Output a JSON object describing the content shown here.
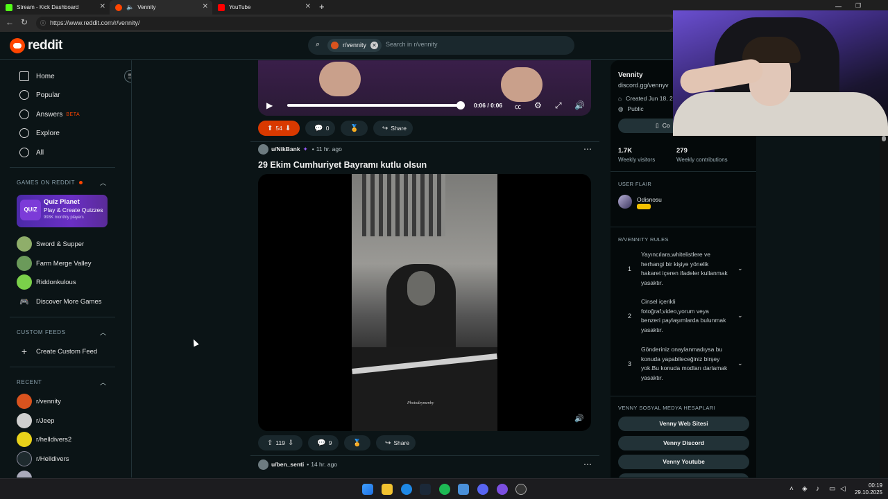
{
  "browser": {
    "tabs": [
      {
        "title": "Stream - Kick Dashboard",
        "favicon_color": "#53fc18"
      },
      {
        "title": "Vennity",
        "favicon_color": "#ff4500"
      },
      {
        "title": "YouTube",
        "favicon_color": "#ff0000"
      }
    ],
    "url": "https://www.reddit.com/r/vennity/"
  },
  "header": {
    "logo_text": "reddit",
    "search_chip": "r/vennity",
    "search_placeholder": "Search in r/vennity"
  },
  "leftnav": {
    "items": [
      {
        "label": "Home"
      },
      {
        "label": "Popular"
      },
      {
        "label": "Answers",
        "badge": "BETA"
      },
      {
        "label": "Explore"
      },
      {
        "label": "All"
      }
    ],
    "games_header": "GAMES ON REDDIT",
    "quiz": {
      "logo": "QUIZ",
      "title": "Quiz Planet",
      "subtitle": "Play & Create Quizzes",
      "players": "993K monthly players"
    },
    "games": [
      {
        "label": "Sword & Supper"
      },
      {
        "label": "Farm Merge Valley"
      },
      {
        "label": "Riddonkulous"
      },
      {
        "label": "Discover More Games"
      }
    ],
    "custom_header": "CUSTOM FEEDS",
    "create_feed": "Create Custom Feed",
    "recent_header": "RECENT",
    "recent": [
      {
        "label": "r/vennity"
      },
      {
        "label": "r/Jeep"
      },
      {
        "label": "r/helldivers2"
      },
      {
        "label": "r/Helldivers"
      }
    ]
  },
  "feed": {
    "post1": {
      "time": "0:06 / 0:06",
      "votes": "54",
      "comments": "0",
      "share": "Share"
    },
    "post2": {
      "user": "u/NikBank",
      "age": "11 hr. ago",
      "title": "29 Ekim Cumhuriyet Bayramı kutlu olsun",
      "watermark": "Photodeymenby",
      "votes": "119",
      "comments": "9",
      "share": "Share"
    },
    "post3": {
      "user": "u/ben_senti",
      "age": "14 hr. ago"
    }
  },
  "sidebar": {
    "name": "Vennity",
    "discord": "discord.gg/vennyv",
    "created": "Created Jun 18, 2",
    "visibility": "Public",
    "button_fragment": "Co",
    "visitors": "1.7K",
    "visitors_label": "Weekly visitors",
    "contributions": "279",
    "contributions_label": "Weekly contributions",
    "flair_header": "USER FLAIR",
    "flair_user": "Odisnosu",
    "rules_header": "R/VENNITY RULES",
    "rules": [
      {
        "num": "1",
        "text": "Yayıncılara,whitelistlere ve herhangi bir kişiye yönelik hakaret içeren ifadeler kullanmak yasaktır."
      },
      {
        "num": "2",
        "text": "Cinsel içerikli fotoğraf,video,yorum veya benzeri paylaşımlarda bulunmak yasaktır."
      },
      {
        "num": "3",
        "text": "Gönderiniz onaylanmadıysa bu konuda yapabileceğiniz birşey yok.Bu konuda modları darlamak yasaktır."
      }
    ],
    "social_header": "VENNY SOSYAL MEDYA HESAPLARI",
    "links": [
      {
        "label": "Venny Web Sitesi"
      },
      {
        "label": "Venny Discord"
      },
      {
        "label": "Venny Youtube"
      }
    ]
  },
  "taskbar": {
    "time": "00:19",
    "date": "29.10.2025"
  }
}
